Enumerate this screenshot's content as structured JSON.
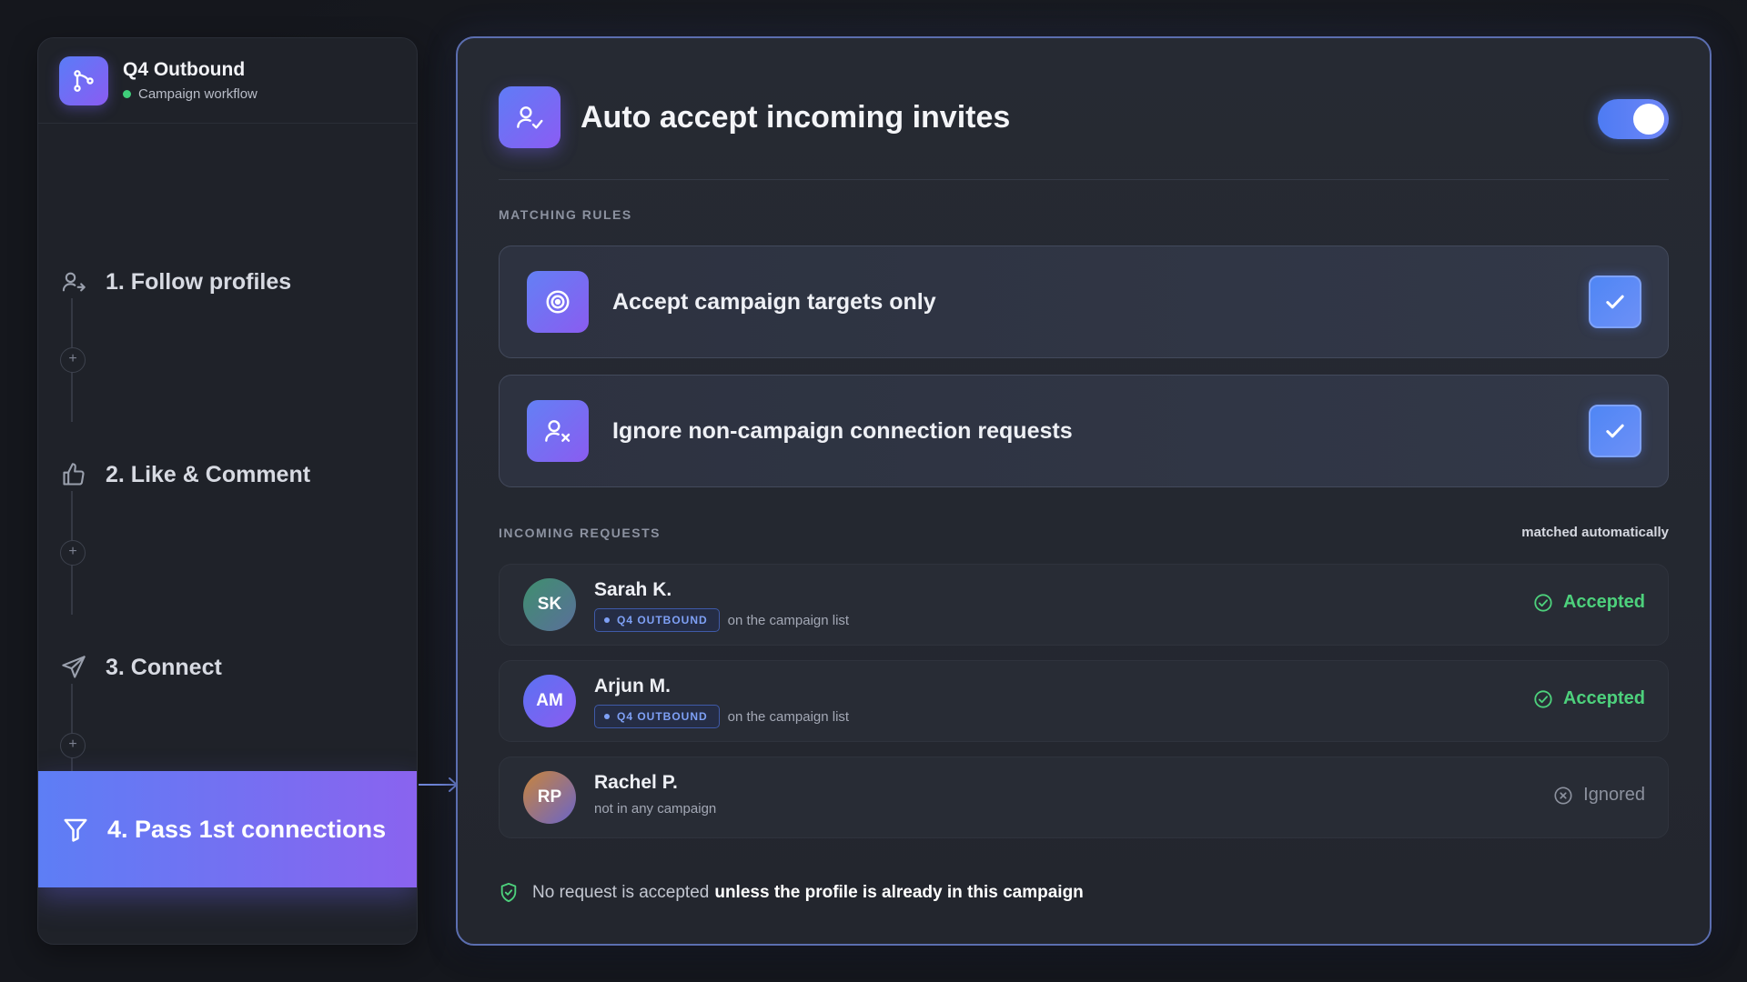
{
  "sidebar": {
    "workflow_title": "Q4 Outbound",
    "workflow_subtitle": "Campaign workflow",
    "steps": [
      {
        "label": "1. Follow profiles",
        "icon": "user-follow-icon"
      },
      {
        "label": "2. Like & Comment",
        "icon": "thumbs-up-icon"
      },
      {
        "label": "3. Connect",
        "icon": "send-icon"
      },
      {
        "label": "4. Pass 1st connections",
        "icon": "filter-icon",
        "active": true
      }
    ],
    "add_step_symbol": "+"
  },
  "panel": {
    "title": "Auto accept incoming invites",
    "toggle_on": true,
    "matching_rules_label": "MATCHING RULES",
    "rules": [
      {
        "label": "Accept campaign targets only",
        "icon": "target-icon",
        "checked": true
      },
      {
        "label": "Ignore non-campaign connection requests",
        "icon": "user-x-icon",
        "checked": true
      }
    ],
    "incoming_label": "INCOMING REQUESTS",
    "incoming_note": "matched automatically",
    "requests": [
      {
        "initials": "SK",
        "name": "Sarah K.",
        "tag": "Q4 OUTBOUND",
        "note": "on the campaign list",
        "status": "Accepted"
      },
      {
        "initials": "AM",
        "name": "Arjun M.",
        "tag": "Q4 OUTBOUND",
        "note": "on the campaign list",
        "status": "Accepted"
      },
      {
        "initials": "RP",
        "name": "Rachel P.",
        "tag": "",
        "note": "not in any campaign",
        "status": "Ignored"
      }
    ],
    "footer_part1": "No request is accepted",
    "footer_part2": "unless the profile is already in this campaign"
  },
  "colors": {
    "accent_gradient_start": "#5d7ef5",
    "accent_gradient_end": "#8a63ef",
    "accepted": "#4dd17c",
    "ignored": "#8c919e",
    "background": "#15171d"
  }
}
